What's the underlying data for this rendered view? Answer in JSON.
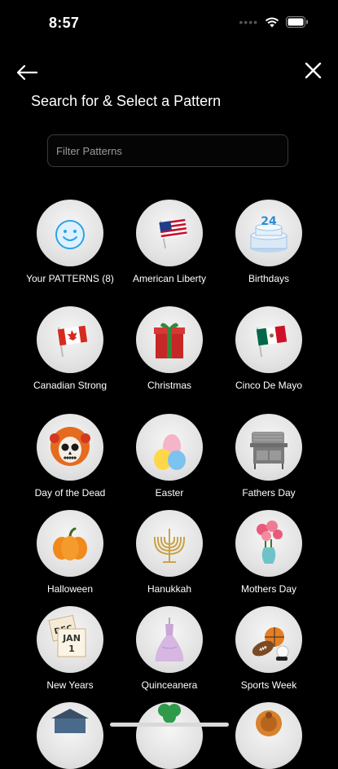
{
  "status": {
    "time": "8:57"
  },
  "header": {
    "title": "Search for & Select a Pattern"
  },
  "search": {
    "placeholder": "Filter Patterns",
    "value": ""
  },
  "patterns": [
    {
      "label": "Your PATTERNS (8)",
      "icon": "smiley-icon"
    },
    {
      "label": "American Liberty",
      "icon": "us-flag-icon"
    },
    {
      "label": "Birthdays",
      "icon": "birthday-cake-icon"
    },
    {
      "label": "Canadian Strong",
      "icon": "canada-flag-icon"
    },
    {
      "label": "Christmas",
      "icon": "gift-box-icon"
    },
    {
      "label": "Cinco De Mayo",
      "icon": "mexico-flag-icon"
    },
    {
      "label": "Day of the Dead",
      "icon": "sugar-skull-icon"
    },
    {
      "label": "Easter",
      "icon": "easter-eggs-icon"
    },
    {
      "label": "Fathers Day",
      "icon": "grill-icon"
    },
    {
      "label": "Halloween",
      "icon": "pumpkin-icon"
    },
    {
      "label": "Hanukkah",
      "icon": "menorah-icon"
    },
    {
      "label": "Mothers Day",
      "icon": "flower-vase-icon"
    },
    {
      "label": "New Years",
      "icon": "calendar-jan-1-icon"
    },
    {
      "label": "Quinceanera",
      "icon": "dress-icon"
    },
    {
      "label": "Sports Week",
      "icon": "sports-balls-icon"
    }
  ]
}
